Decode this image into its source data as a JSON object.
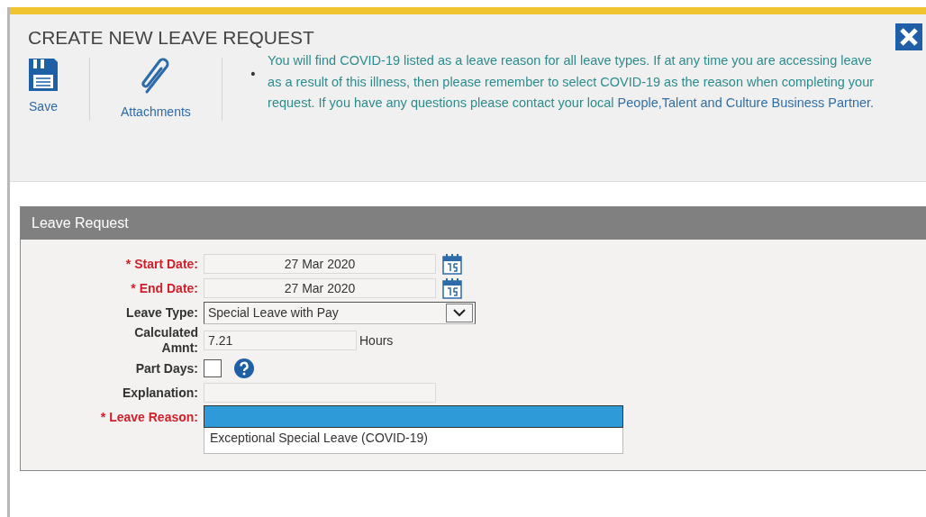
{
  "window": {
    "title": "CREATE NEW LEAVE REQUEST"
  },
  "toolbar": [
    {
      "kind": "save",
      "label": "Save"
    },
    {
      "kind": "attach",
      "label": "Attachments"
    }
  ],
  "notice": {
    "bullet": "•",
    "text": "You will find COVID-19 listed as a leave reason for all leave types. If at any time you are accessing leave as a result of this illness, then please remember to select COVID-19 as the reason when completing your request. If you have any questions please contact your local ",
    "link": "People,Talent and Culture Business Partner."
  },
  "panel": {
    "title": "Leave Request"
  },
  "fields": [
    {
      "kind": "date",
      "label": "* Start Date:",
      "required": true,
      "value": "27 Mar 2020"
    },
    {
      "kind": "date",
      "label": "* End Date:",
      "required": true,
      "value": "27 Mar 2020"
    },
    {
      "kind": "select",
      "label": "Leave Type:",
      "required": false,
      "value": "Special Leave with Pay"
    },
    {
      "kind": "number",
      "label": "Calculated Amnt:",
      "required": false,
      "value": "7.21",
      "unit": "Hours"
    },
    {
      "kind": "checkbox",
      "label": "Part Days:",
      "required": false,
      "checked": false
    },
    {
      "kind": "text",
      "label": "Explanation:",
      "required": false
    },
    {
      "kind": "list",
      "label": "* Leave Reason:",
      "required": true,
      "focused": true,
      "options": [
        {
          "label": "Exceptional Special Leave (COVID-19)",
          "selected": false
        }
      ]
    }
  ]
}
